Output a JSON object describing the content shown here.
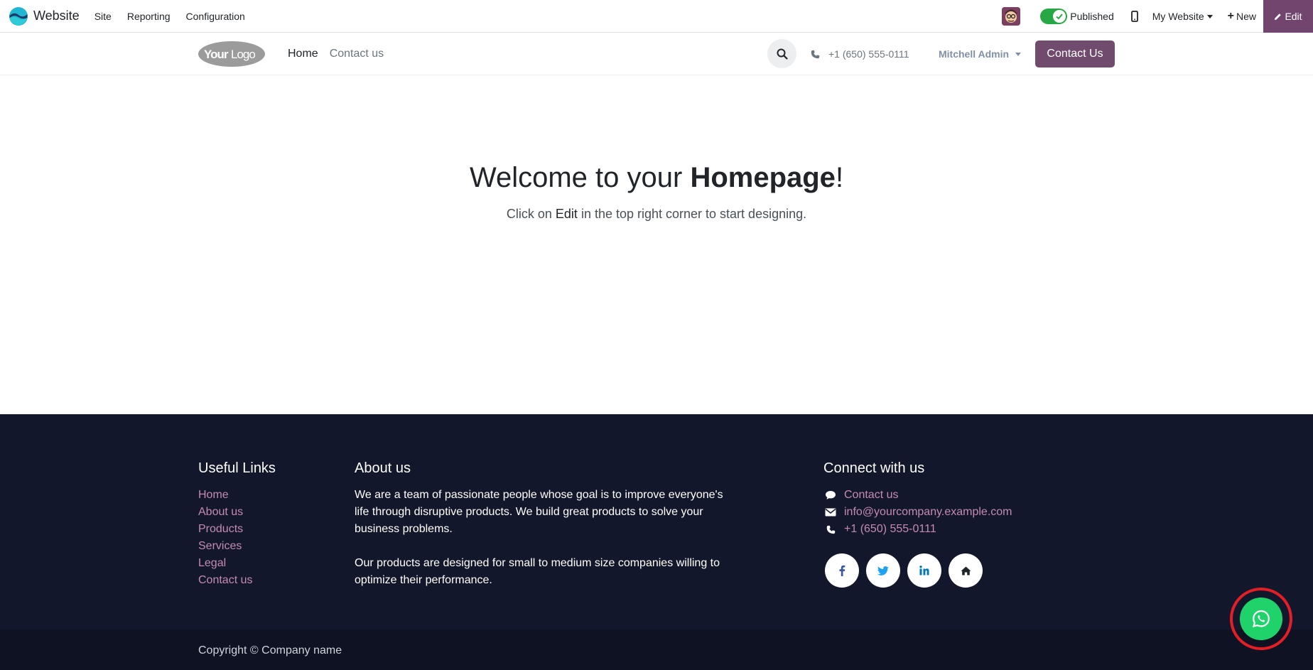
{
  "adminbar": {
    "app_name": "Website",
    "menu": [
      "Site",
      "Reporting",
      "Configuration"
    ],
    "published_label": "Published",
    "website_menu": "My Website",
    "new_label": "New",
    "edit_label": "Edit",
    "accent_color": "#71456d",
    "toggle_color": "#28a745"
  },
  "header": {
    "logo_text": "YourLogo",
    "nav": [
      {
        "label": "Home",
        "active": true
      },
      {
        "label": "Contact us",
        "active": false
      }
    ],
    "phone": "+1 (650) 555-0111",
    "user": "Mitchell Admin",
    "cta_label": "Contact Us"
  },
  "hero": {
    "title_prefix": "Welcome to your ",
    "title_bold": "Homepage",
    "title_suffix": "!",
    "sub_prefix": "Click on ",
    "sub_em": "Edit",
    "sub_suffix": " in the top right corner to start designing."
  },
  "footer": {
    "useful_title": "Useful Links",
    "useful_links": [
      "Home",
      "About us",
      "Products",
      "Services",
      "Legal",
      "Contact us"
    ],
    "about_title": "About us",
    "about_p1": "We are a team of passionate people whose goal is to improve everyone's life through disruptive products. We build great products to solve your business problems.",
    "about_p2": "Our products are designed for small to medium size companies willing to optimize their performance.",
    "connect_title": "Connect with us",
    "contact_rows": [
      {
        "icon": "comment-icon",
        "text": "Contact us"
      },
      {
        "icon": "envelope-icon",
        "text": "info@yourcompany.example.com"
      },
      {
        "icon": "phone-icon",
        "text": "+1 (650) 555-0111"
      }
    ],
    "socials": [
      "facebook-icon",
      "twitter-icon",
      "linkedin-icon",
      "home-icon"
    ],
    "copyright": "Copyright © Company name",
    "link_color": "#c48ab5",
    "bg_color": "#13172b"
  },
  "floating": {
    "icon": "whatsapp-icon",
    "color": "#1fd26a",
    "highlight_color": "#e41e26"
  }
}
